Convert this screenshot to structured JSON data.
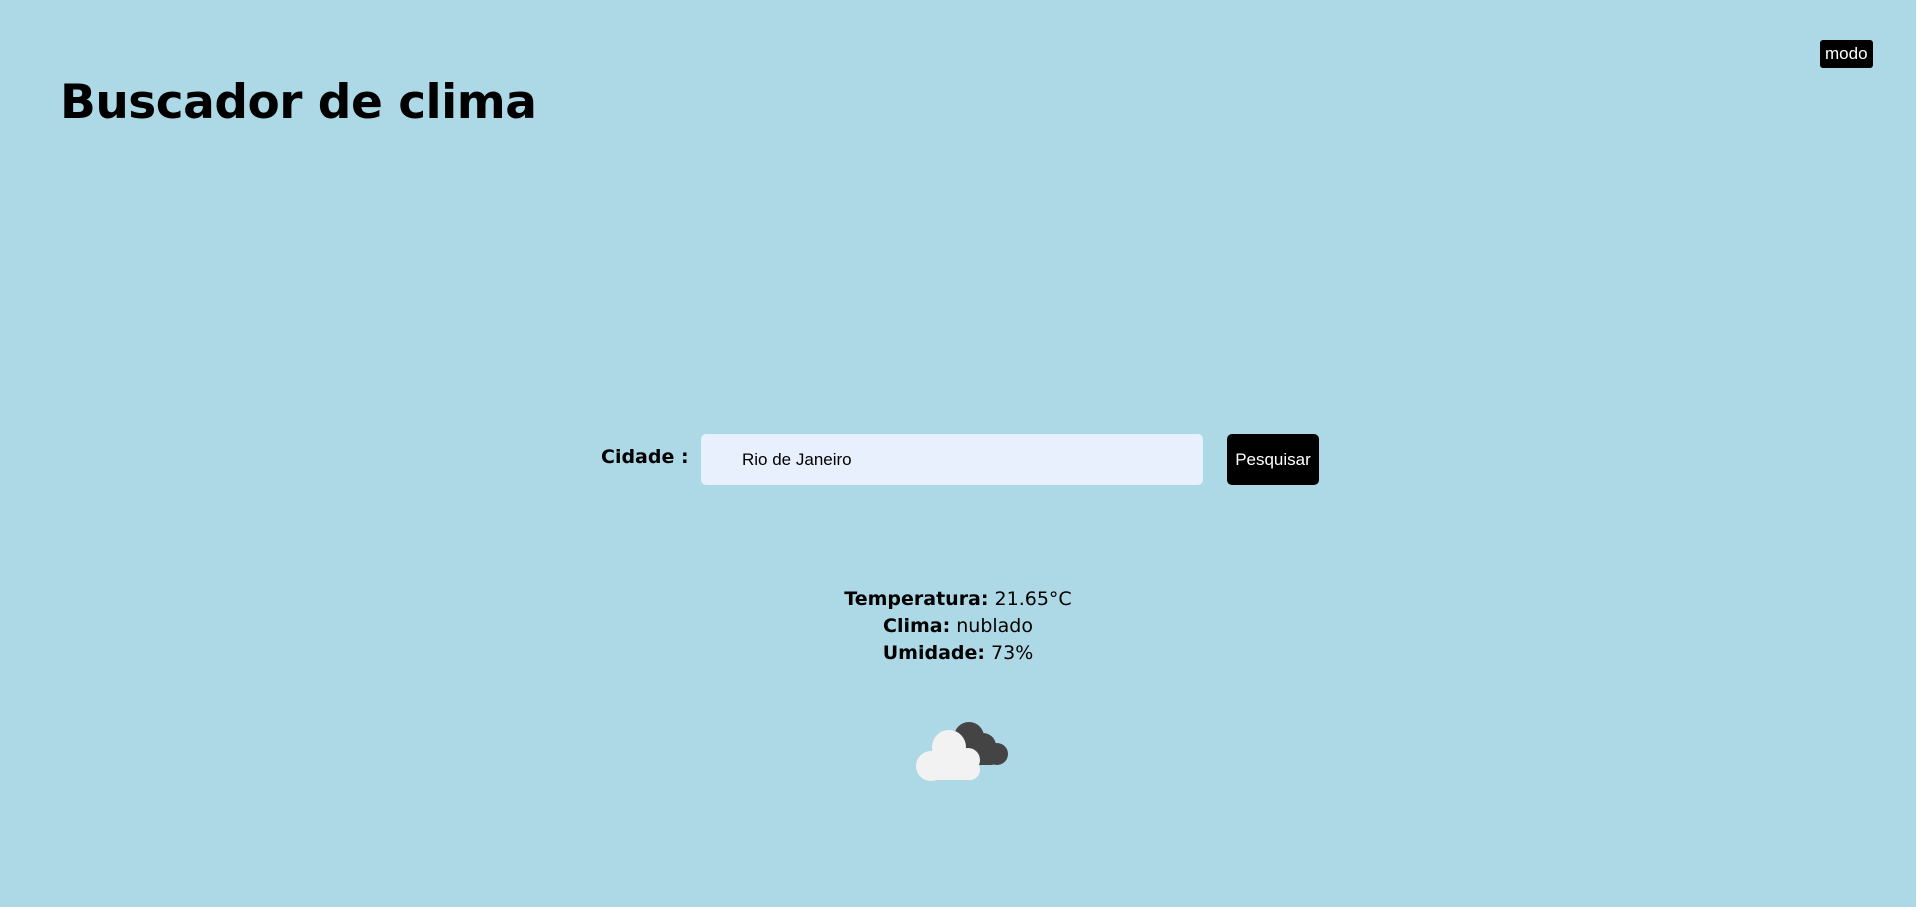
{
  "header": {
    "mode_button_label": "modo",
    "title": "Buscador de clima"
  },
  "search": {
    "label": "Cidade :",
    "value": "Rio de Janeiro",
    "button_label": "Pesquisar"
  },
  "results": {
    "temperature_label": "Temperatura:",
    "temperature_value": "21.65°C",
    "weather_label": "Clima:",
    "weather_value": "nublado",
    "humidity_label": "Umidade:",
    "humidity_value": "73%"
  },
  "weather_icon": {
    "name": "cloudy-icon"
  },
  "colors": {
    "background": "#add8e6",
    "input_background": "#e8f0fe",
    "button_background": "#000000",
    "button_text": "#ffffff"
  }
}
